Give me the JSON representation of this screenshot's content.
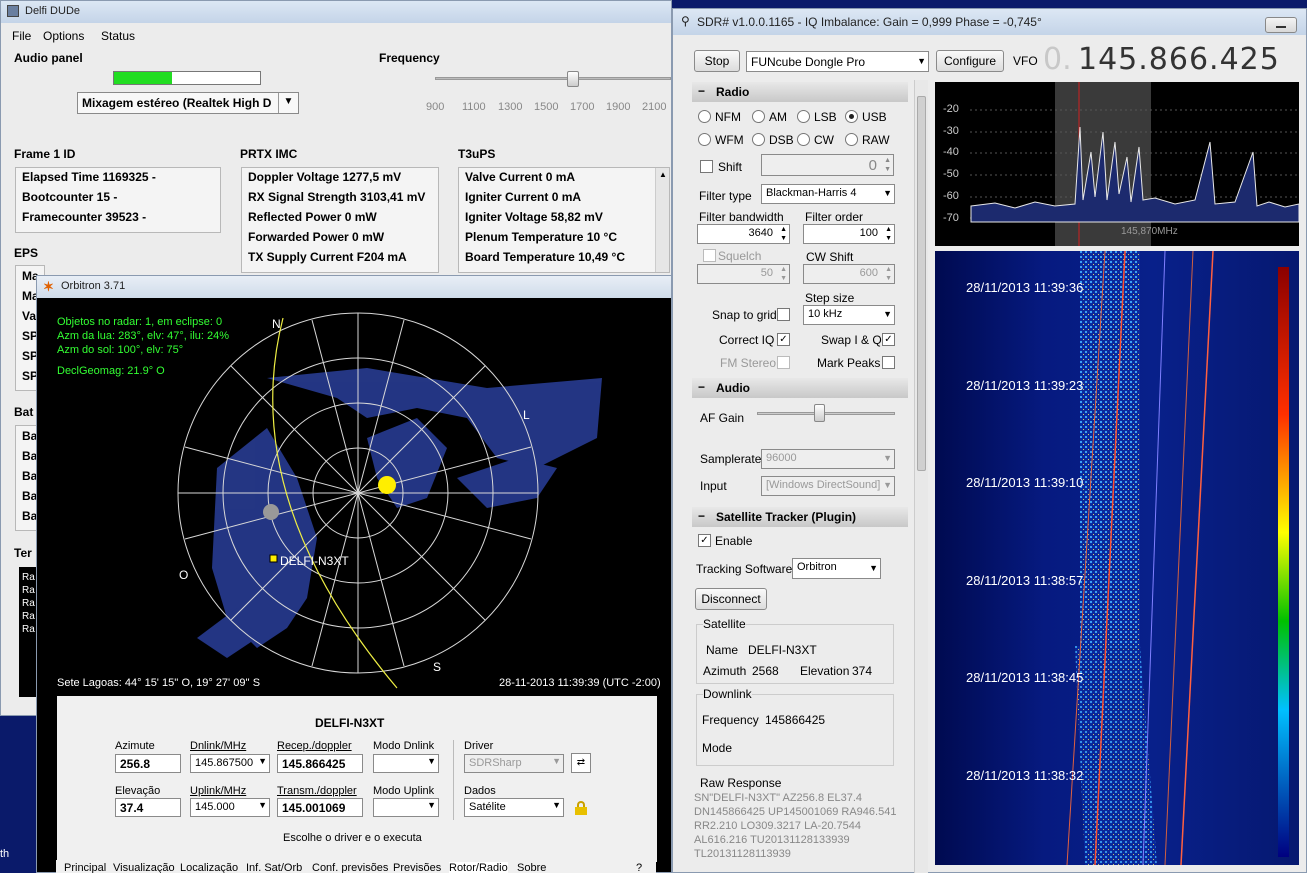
{
  "delfi": {
    "title": "Delfi DUDe",
    "menu": [
      "File",
      "Options",
      "Status"
    ],
    "audio_panel": {
      "label": "Audio panel",
      "device": "Mixagem estéreo (Realtek High D",
      "level": 0.4
    },
    "frequency": {
      "label": "Frequency",
      "ticks": [
        "900",
        "1100",
        "1300",
        "1500",
        "1700",
        "1900",
        "2100"
      ]
    },
    "frame": {
      "label": "Frame 1 ID",
      "rows": [
        {
          "k": "Elapsed Time",
          "v": "1169325",
          "u": "-"
        },
        {
          "k": "Bootcounter",
          "v": "15",
          "u": "-"
        },
        {
          "k": "Framecounter",
          "v": "39523",
          "u": "-"
        }
      ]
    },
    "prtx": {
      "label": "PRTX IMC",
      "rows": [
        {
          "k": "Doppler Voltage",
          "v": "1277,5",
          "u": "mV"
        },
        {
          "k": "RX Signal Strength",
          "v": "3103,41",
          "u": "mV"
        },
        {
          "k": "Reflected Power",
          "v": "0",
          "u": "mW"
        },
        {
          "k": "Forwarded Power",
          "v": "0",
          "u": "mW"
        },
        {
          "k": "TX Supply Current",
          "v": "F204",
          "u": "mA"
        }
      ]
    },
    "t3ups": {
      "label": "T3uPS",
      "rows": [
        {
          "k": "Valve Current",
          "v": "0",
          "u": "mA"
        },
        {
          "k": "Igniter Current",
          "v": "0",
          "u": "mA"
        },
        {
          "k": "Igniter Voltage",
          "v": "58,82",
          "u": "mV"
        },
        {
          "k": "Plenum Temperature",
          "v": "10",
          "u": "°C"
        },
        {
          "k": "Board Temperature",
          "v": "10,49",
          "u": "°C"
        }
      ]
    },
    "eps_label": "EPS",
    "eps_peek": [
      "Ma",
      "Ma",
      "Va",
      "SP",
      "SP",
      "SP"
    ],
    "bat_label": "Bat",
    "bat_peek": [
      "Ba",
      "Ba",
      "Ba",
      "Ba",
      "Ba"
    ],
    "ter_label": "Ter",
    "ter_peek": [
      "Ra",
      "Ra",
      "Ra",
      "Ra",
      "Ra"
    ],
    "bottom_peek": "th"
  },
  "orbitron": {
    "title": "Orbitron 3.71",
    "info": [
      "Objetos no radar: 1, em eclipse: 0",
      "Azm da lua: 283°, elv: 47°, ilu: 24%",
      "Azm do sol: 100°, elv: 75°"
    ],
    "declgeomag": "DeclGeomag: 21.9° O",
    "compass": {
      "n": "N",
      "l": "L",
      "s": "S",
      "o": "O"
    },
    "satellite_label": "DELFI-N3XT",
    "location": "Sete Lagoas: 44° 15' 15'' O, 19° 27' 09'' S",
    "datetime": "28-11-2013 11:39:39 (UTC -2:00)",
    "panel": {
      "sat_name": "DELFI-N3XT",
      "azimute_label": "Azimute",
      "azimute": "256.8",
      "elevacao_label": "Elevação",
      "elevacao": "37.4",
      "dnlink_label": "Dnlink/MHz",
      "dnlink": "145.867500",
      "uplink_label": "Uplink/MHz",
      "uplink": "145.000",
      "recep_label": "Recep./doppler",
      "recep": "145.866425",
      "transm_label": "Transm./doppler",
      "transm": "145.001069",
      "modo_dn_label": "Modo Dnlink",
      "modo_up_label": "Modo Uplink",
      "driver_label": "Driver",
      "driver": "SDRSharp",
      "dados_label": "Dados",
      "dados": "Satélite",
      "hint": "Escolhe o driver e o executa"
    },
    "tabs": [
      "Principal",
      "Visualização",
      "Localização",
      "Inf. Sat/Orb",
      "Conf. previsões",
      "Previsões",
      "Rotor/Radio",
      "Sobre"
    ],
    "help": "?"
  },
  "sdr": {
    "title": "SDR# v1.0.0.1165 - IQ Imbalance: Gain = 0,999 Phase = -0,745°",
    "stop": "Stop",
    "device": "FUNcube Dongle Pro",
    "configure": "Configure",
    "vfo_label": "VFO",
    "vfo_dim": "0.",
    "vfo_value": "145.866.425",
    "radio": {
      "label": "Radio",
      "modes": [
        "NFM",
        "AM",
        "LSB",
        "USB",
        "WFM",
        "DSB",
        "CW",
        "RAW"
      ],
      "selected": "USB",
      "shift_label": "Shift",
      "shift_value": "0",
      "filter_type_label": "Filter type",
      "filter_type": "Blackman-Harris 4",
      "bandwidth_label": "Filter bandwidth",
      "bandwidth": "3640",
      "order_label": "Filter order",
      "order": "100",
      "squelch_label": "Squelch",
      "squelch": "50",
      "cwshift_label": "CW Shift",
      "cwshift": "600",
      "step_label": "Step size",
      "step": "10 kHz",
      "snap_label": "Snap to grid",
      "correct_iq_label": "Correct IQ",
      "swap_iq_label": "Swap I & Q",
      "fm_stereo_label": "FM Stereo",
      "mark_peaks_label": "Mark Peaks"
    },
    "audio": {
      "label": "Audio",
      "af_gain_label": "AF Gain",
      "af_gain": 0.45,
      "samplerate_label": "Samplerate",
      "samplerate": "96000",
      "input_label": "Input",
      "input": "[Windows DirectSound]"
    },
    "tracker": {
      "label": "Satellite Tracker (Plugin)",
      "enable_label": "Enable",
      "tracking_label": "Tracking Software",
      "tracking": "Orbitron",
      "disconnect": "Disconnect",
      "satellite_group": "Satellite",
      "name_label": "Name",
      "name": "DELFI-N3XT",
      "azimuth_label": "Azimuth",
      "azimuth": "2568",
      "elevation_label": "Elevation",
      "elevation": "374",
      "downlink_group": "Downlink",
      "frequency_label": "Frequency",
      "frequency": "145866425",
      "mode_label": "Mode",
      "raw_label": "Raw Response",
      "raw_lines": [
        "SN\"DELFI-N3XT\" AZ256.8 EL37.4",
        "DN145866425 UP145001069 RA946.541",
        "RR2.210 LO309.3217 LA-20.7544",
        "AL616.216 TU20131128133939",
        "TL20131128113939"
      ]
    },
    "spectrum": {
      "y_ticks": [
        "-20",
        "-30",
        "-40",
        "-50",
        "-60",
        "-70"
      ],
      "freq_label": "145,870MHz"
    },
    "waterfall_times": [
      "28/11/2013 11:39:36",
      "28/11/2013 11:39:23",
      "28/11/2013 11:39:10",
      "28/11/2013 11:38:57",
      "28/11/2013 11:38:45",
      "28/11/2013 11:38:32"
    ]
  }
}
